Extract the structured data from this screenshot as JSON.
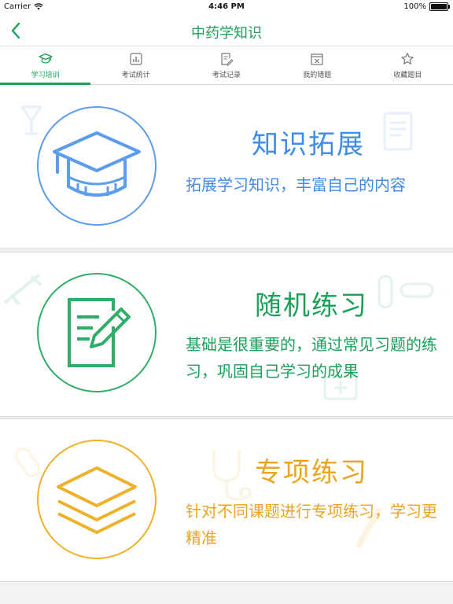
{
  "status_bar": {
    "carrier": "Carrier",
    "time": "4:46 PM",
    "battery": "100%"
  },
  "nav": {
    "title": "中药学知识",
    "back_icon": "chevron-left-icon"
  },
  "tabs": [
    {
      "label": "学习培训",
      "icon": "graduation-cap-icon",
      "active": true
    },
    {
      "label": "考试统计",
      "icon": "bar-chart-icon",
      "active": false
    },
    {
      "label": "考试记录",
      "icon": "edit-doc-icon",
      "active": false
    },
    {
      "label": "我的错题",
      "icon": "wrong-box-icon",
      "active": false
    },
    {
      "label": "收藏题目",
      "icon": "star-icon",
      "active": false
    }
  ],
  "cards": [
    {
      "title": "知识拓展",
      "desc": "拓展学习知识，丰富自己的内容",
      "color": "#3f8be6",
      "icon": "graduation-cap-icon"
    },
    {
      "title": "随机练习",
      "desc": "基础是很重要的，通过常见习题的练习，巩固自己学习的成果",
      "color": "#1ba05a",
      "icon": "pencil-paper-icon"
    },
    {
      "title": "专项练习",
      "desc": "针对不同课题进行专项练习，学习更精准",
      "color": "#eba41f",
      "icon": "layers-icon"
    }
  ],
  "accent_color": "#1ba05a"
}
